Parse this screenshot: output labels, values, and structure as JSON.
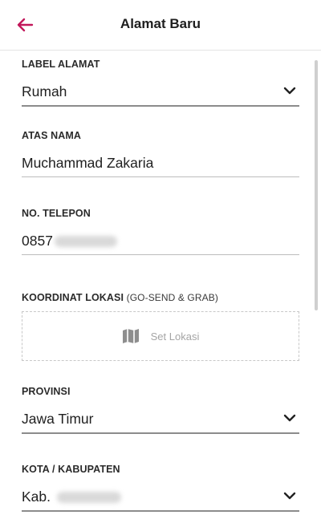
{
  "header": {
    "title": "Alamat Baru",
    "back_icon": "arrow-left-icon",
    "accent_color": "#c2185b"
  },
  "form": {
    "label_alamat": {
      "label": "LABEL ALAMAT",
      "value": "Rumah"
    },
    "atas_nama": {
      "label": "ATAS NAMA",
      "value": "Muchammad Zakaria"
    },
    "no_telepon": {
      "label": "NO. TELEPON",
      "value": "0857"
    },
    "koordinat": {
      "label": "KOORDINAT LOKASI",
      "sublabel": "(GO-SEND & GRAB)",
      "button_label": "Set Lokasi",
      "icon": "map-icon"
    },
    "provinsi": {
      "label": "PROVINSI",
      "value": "Jawa Timur"
    },
    "kota": {
      "label": "KOTA / KABUPATEN",
      "value": "Kab."
    }
  }
}
